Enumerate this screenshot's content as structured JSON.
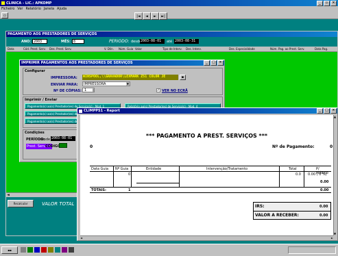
{
  "app": {
    "title": "CLINICA - LIC.: APKOMP"
  },
  "menu": [
    "Ficheiro",
    "Ver",
    "Relatório",
    "Janela",
    "Ajuda"
  ],
  "nav_buttons": [
    "|◄",
    "◄",
    "►",
    "►|"
  ],
  "main_window": {
    "title": "PAGAMENTO AOS PRESTADORES DE SERVIÇOS",
    "ano_label": "ANO:",
    "ano_value": "2003",
    "mes_label": "MÊS:",
    "mes_value": "8",
    "periodo_label": "PERIODO:",
    "desde_label": "desde",
    "desde_value": "2003-08-01",
    "ate_label": "até",
    "ate_value": "2003-08-31",
    "columns": [
      "Data",
      "Cód. Prest. Serv.",
      "Des. Prest. Serv.",
      "V. Dlin.",
      "Núm. Guia",
      "Valor",
      "Tipo de Interv.",
      "Des. Interv.",
      "Des. Especialidade",
      "Núm. Pag. ao Prest. Serv.",
      "Data Pag."
    ],
    "recalcular_label": "Recalcular",
    "valor_total_label": "VALOR TOTAL"
  },
  "print_dialog": {
    "title": "IMPRIMIR PAGAMENTOS AOS PRESTADORES DE SERVIÇOS",
    "config_label": "Configurar",
    "impressora_label": "IMPRESSORA:",
    "impressora_value": "WINSPOOL,\\\\GRAVADOR\\LEXMARK Z51 COLOR JE",
    "enviar_label": "ENVIAR PARA:",
    "enviar_value": "IMPRESSORA",
    "copias_label": "Nº DE CÓPIAS:",
    "copias_value": "1",
    "ver_ecra_label": "VER NO ECRÃ",
    "ver_ecra_checked": true,
    "imprimir_label": "Imprimir / Enviar",
    "buttons": [
      "Pagamento(s) ao(s) Prestador(es) de Serviço(s) - Mod. 1",
      "Relatório ao(s) Prestador(es) de Serviço(s) - Mod. 4",
      "Pagamento(s) ao(s) Prestador(es) de",
      "Pagamento(s) ao(s) Prestador(es) de"
    ],
    "condicoes_label": "Condições",
    "periodo_label": "PERÍODO:",
    "desde_label": "desde",
    "desde_value": "2003-08-01",
    "prest_label": "Prest. Serv. ->",
    "codigo_label": "CÓDIGO:"
  },
  "report": {
    "title": "CLIMPPS1 - Report",
    "heading": "*** PAGAMENTO A PREST. SERVIÇOS ***",
    "code_value": "0",
    "num_pag_label": "Nº de Pagamento:",
    "num_pag_value": "0",
    "table_headers": [
      "Data Guia",
      "Nº Guia",
      "Entidade",
      "Intervenção/Tratamento",
      "Total",
      "P/ Médico"
    ],
    "row1": {
      "data": "",
      "guia": "0",
      "entidade": "",
      "interv": "",
      "total": "0.0",
      "medico": "0.00 (  0 %)"
    },
    "subtotal_value": "0.00",
    "totais_label": "TOTAIS:",
    "totais_guia": "1",
    "totais_value": "0.00",
    "irs_label": "IRS:",
    "irs_value": "0.00",
    "valor_receber_label": "VALOR A RECEBER:",
    "valor_receber_value": "0.00"
  },
  "colors": {
    "titlebar": "#000080",
    "teal": "#008080",
    "green": "#00c800",
    "gray": "#c0c0c0"
  }
}
